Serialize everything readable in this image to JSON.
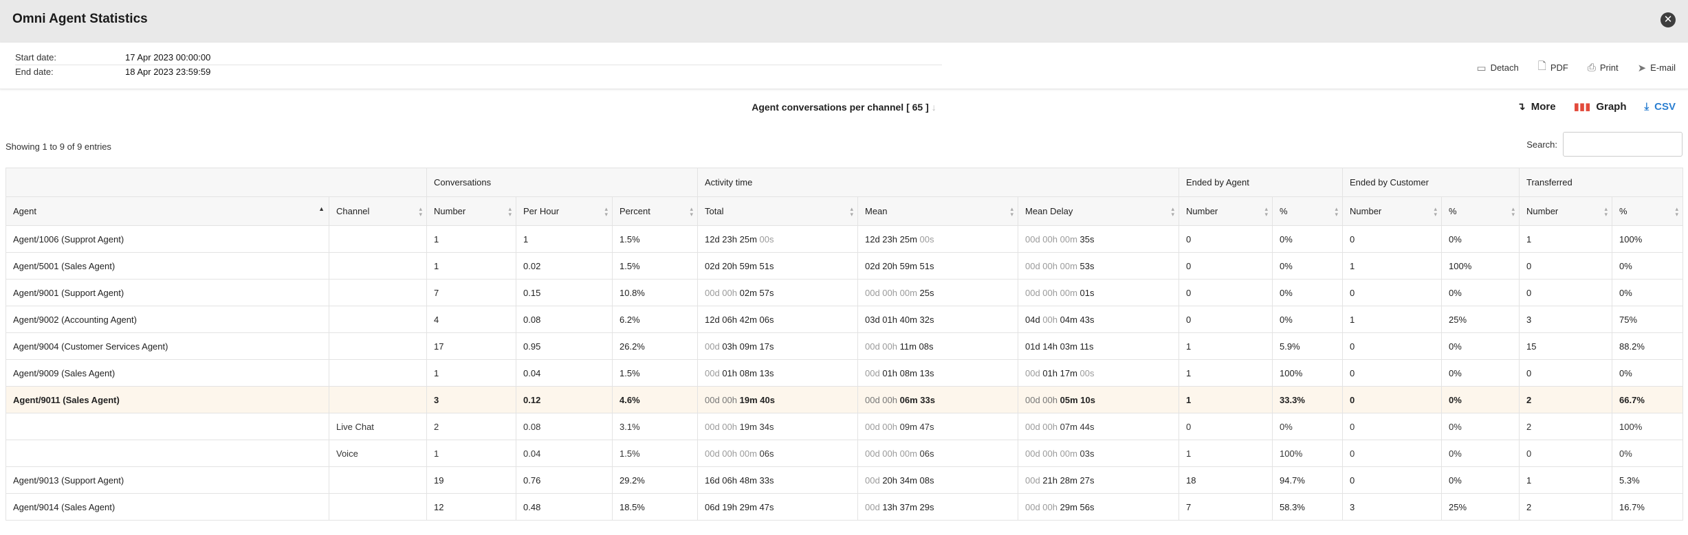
{
  "window": {
    "title": "Omni Agent Statistics"
  },
  "info": {
    "start_label": "Start date:",
    "start_value": "17 Apr 2023 00:00:00",
    "end_label": "End date:",
    "end_value": "18 Apr 2023 23:59:59"
  },
  "actions": {
    "detach": "Detach",
    "pdf": "PDF",
    "print": "Print",
    "email": "E-mail"
  },
  "report": {
    "title": "Agent conversations per channel [ 65 ]"
  },
  "toolbar": {
    "more": "More",
    "graph": "Graph",
    "csv": "CSV"
  },
  "showing": "Showing 1 to 9 of 9 entries",
  "search": {
    "label": "Search:",
    "placeholder": ""
  },
  "table": {
    "groups": [
      "Conversations",
      "Activity time",
      "Ended by Agent",
      "Ended by Customer",
      "Transferred"
    ],
    "columns": [
      "Agent",
      "Channel",
      "Number",
      "Per Hour",
      "Percent",
      "Total",
      "Mean",
      "Mean Delay",
      "Number",
      "%",
      "Number",
      "%",
      "Number",
      "%"
    ],
    "rows": [
      {
        "agent": "Agent/1006 (Supprot Agent)",
        "channel": "",
        "number": "1",
        "per_hour": "1",
        "percent": "1.5%",
        "total": [
          "",
          "12d 23h 25m",
          " 00s"
        ],
        "mean": [
          "",
          "12d 23h 25m",
          " 00s"
        ],
        "delay": [
          "00d 00h 00m",
          " 35s",
          ""
        ],
        "ea_n": "0",
        "ea_p": "0%",
        "ec_n": "0",
        "ec_p": "0%",
        "tr_n": "1",
        "tr_p": "100%"
      },
      {
        "agent": "Agent/5001 (Sales Agent)",
        "channel": "",
        "number": "1",
        "per_hour": "0.02",
        "percent": "1.5%",
        "total": [
          "",
          "02d 20h 59m 51s",
          ""
        ],
        "mean": [
          "",
          "02d 20h 59m 51s",
          ""
        ],
        "delay": [
          "00d 00h 00m",
          " 53s",
          ""
        ],
        "ea_n": "0",
        "ea_p": "0%",
        "ec_n": "1",
        "ec_p": "100%",
        "tr_n": "0",
        "tr_p": "0%"
      },
      {
        "agent": "Agent/9001 (Support Agent)",
        "channel": "",
        "number": "7",
        "per_hour": "0.15",
        "percent": "10.8%",
        "total": [
          "00d 00h",
          " 02m 57s",
          ""
        ],
        "mean": [
          "00d 00h 00m",
          " 25s",
          ""
        ],
        "delay": [
          "00d 00h 00m",
          " 01s",
          ""
        ],
        "ea_n": "0",
        "ea_p": "0%",
        "ec_n": "0",
        "ec_p": "0%",
        "tr_n": "0",
        "tr_p": "0%"
      },
      {
        "agent": "Agent/9002 (Accounting Agent)",
        "channel": "",
        "number": "4",
        "per_hour": "0.08",
        "percent": "6.2%",
        "total": [
          "",
          "12d 06h 42m 06s",
          ""
        ],
        "mean": [
          "",
          "03d 01h 40m 32s",
          ""
        ],
        "delay": [
          "",
          "04d",
          " 00h",
          " 04m 43s"
        ],
        "ea_n": "0",
        "ea_p": "0%",
        "ec_n": "1",
        "ec_p": "25%",
        "tr_n": "3",
        "tr_p": "75%"
      },
      {
        "agent": "Agent/9004 (Customer Services Agent)",
        "channel": "",
        "number": "17",
        "per_hour": "0.95",
        "percent": "26.2%",
        "total": [
          "00d",
          " 03h 09m 17s",
          ""
        ],
        "mean": [
          "00d 00h",
          " 11m 08s",
          ""
        ],
        "delay": [
          "",
          "01d 14h 03m 11s",
          ""
        ],
        "ea_n": "1",
        "ea_p": "5.9%",
        "ec_n": "0",
        "ec_p": "0%",
        "tr_n": "15",
        "tr_p": "88.2%"
      },
      {
        "agent": "Agent/9009 (Sales Agent)",
        "channel": "",
        "number": "1",
        "per_hour": "0.04",
        "percent": "1.5%",
        "total": [
          "00d",
          " 01h 08m 13s",
          ""
        ],
        "mean": [
          "00d",
          " 01h 08m 13s",
          ""
        ],
        "delay": [
          "00d",
          " 01h 17m",
          " 00s"
        ],
        "ea_n": "1",
        "ea_p": "100%",
        "ec_n": "0",
        "ec_p": "0%",
        "tr_n": "0",
        "tr_p": "0%"
      },
      {
        "agent": "Agent/9011 (Sales Agent)",
        "channel": "",
        "number": "3",
        "per_hour": "0.12",
        "percent": "4.6%",
        "total": [
          "00d 00h",
          " 19m 40s",
          ""
        ],
        "mean": [
          "00d 00h",
          " 06m 33s",
          ""
        ],
        "delay": [
          "00d 00h",
          " 05m 10s",
          ""
        ],
        "ea_n": "1",
        "ea_p": "33.3%",
        "ec_n": "0",
        "ec_p": "0%",
        "tr_n": "2",
        "tr_p": "66.7%",
        "highlight": true
      },
      {
        "agent": "",
        "channel": "Live Chat",
        "number": "2",
        "per_hour": "0.08",
        "percent": "3.1%",
        "total": [
          "00d 00h",
          " 19m 34s",
          ""
        ],
        "mean": [
          "00d 00h",
          " 09m 47s",
          ""
        ],
        "delay": [
          "00d 00h",
          " 07m 44s",
          ""
        ],
        "ea_n": "0",
        "ea_p": "0%",
        "ec_n": "0",
        "ec_p": "0%",
        "tr_n": "2",
        "tr_p": "100%",
        "sub": true
      },
      {
        "agent": "",
        "channel": "Voice",
        "number": "1",
        "per_hour": "0.04",
        "percent": "1.5%",
        "total": [
          "00d 00h 00m",
          " 06s",
          ""
        ],
        "mean": [
          "00d 00h 00m",
          " 06s",
          ""
        ],
        "delay": [
          "00d 00h 00m",
          " 03s",
          ""
        ],
        "ea_n": "1",
        "ea_p": "100%",
        "ec_n": "0",
        "ec_p": "0%",
        "tr_n": "0",
        "tr_p": "0%",
        "sub": true
      },
      {
        "agent": "Agent/9013 (Support Agent)",
        "channel": "",
        "number": "19",
        "per_hour": "0.76",
        "percent": "29.2%",
        "total": [
          "",
          "16d 06h 48m 33s",
          ""
        ],
        "mean": [
          "00d",
          " 20h 34m 08s",
          ""
        ],
        "delay": [
          "00d",
          " 21h 28m 27s",
          ""
        ],
        "ea_n": "18",
        "ea_p": "94.7%",
        "ec_n": "0",
        "ec_p": "0%",
        "tr_n": "1",
        "tr_p": "5.3%"
      },
      {
        "agent": "Agent/9014 (Sales Agent)",
        "channel": "",
        "number": "12",
        "per_hour": "0.48",
        "percent": "18.5%",
        "total": [
          "",
          "06d 19h 29m 47s",
          ""
        ],
        "mean": [
          "00d",
          " 13h 37m 29s",
          ""
        ],
        "delay": [
          "00d 00h",
          " 29m 56s",
          ""
        ],
        "ea_n": "7",
        "ea_p": "58.3%",
        "ec_n": "3",
        "ec_p": "25%",
        "tr_n": "2",
        "tr_p": "16.7%"
      }
    ]
  },
  "icons": {
    "close": "close-icon",
    "detach": "detach-icon",
    "pdf": "pdf-icon",
    "print": "print-icon",
    "email": "paper-plane-icon",
    "more": "arrow-icon",
    "graph": "bar-chart-icon",
    "csv": "download-icon"
  },
  "colors": {
    "graph_icon": "#e24a3b",
    "csv": "#2b7fd1",
    "highlight_row": "#fdf6ec"
  }
}
